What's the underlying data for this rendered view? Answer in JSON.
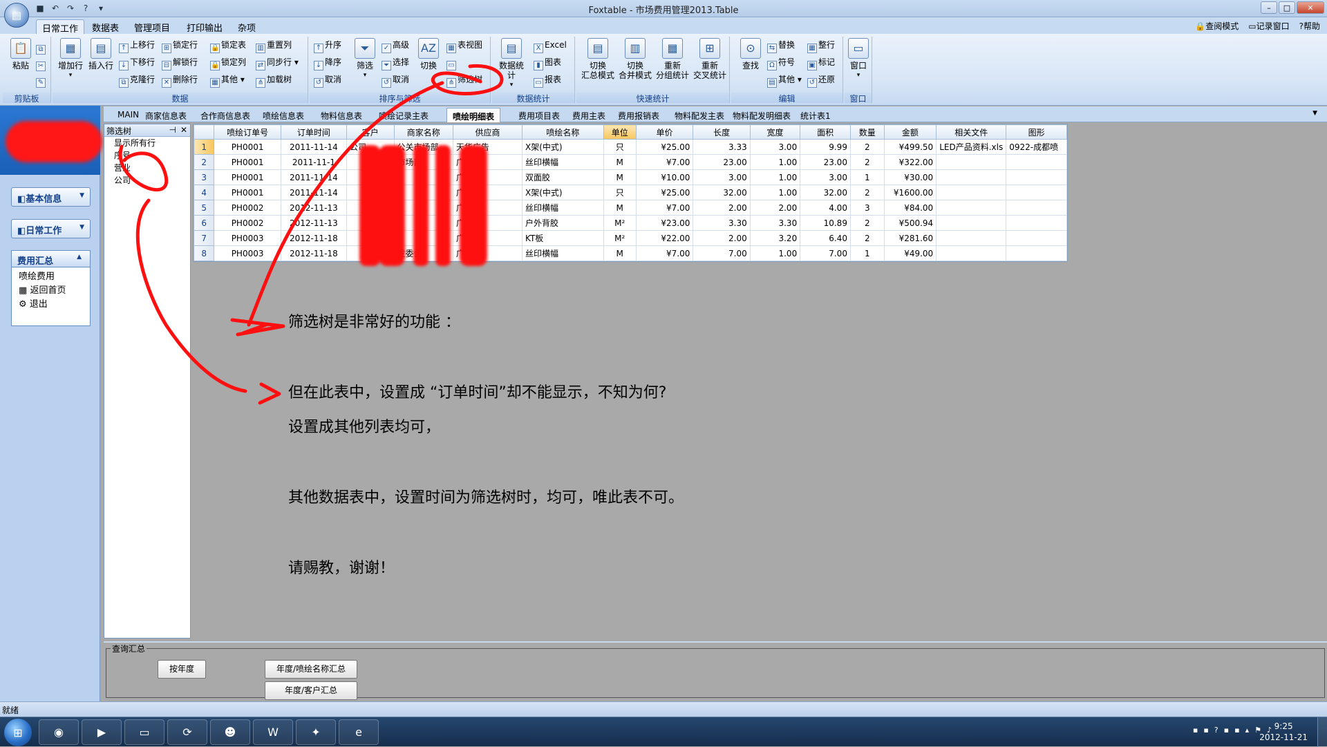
{
  "window": {
    "title": "Foxtable - 市场费用管理2013.Table"
  },
  "ribbon_tabs": [
    "日常工作",
    "数据表",
    "管理项目",
    "打印输出",
    "杂项"
  ],
  "right_links": [
    "查阅模式",
    "记录窗口",
    "帮助"
  ],
  "ribbon": {
    "clipboard": {
      "paste": "粘贴",
      "label": "剪贴板"
    },
    "data": {
      "add_row": "增加行",
      "insert_row": "插入行",
      "small": [
        "上移行",
        "锁定行",
        "锁定表",
        "重置列",
        "下移行",
        "解锁行",
        "锁定列",
        "同步行",
        "克隆行",
        "删除行",
        "其他",
        "加载树"
      ],
      "label": "数据"
    },
    "sort": {
      "small": [
        "升序",
        "降序",
        "取消",
        "高级",
        "选择",
        "取消"
      ],
      "filter": "筛选",
      "switch": "切换",
      "views": [
        "表视图",
        "筛选树"
      ],
      "label": "排序与筛选"
    },
    "stats": {
      "data_stats": "数据统计",
      "excel": "Excel",
      "chart": "图表",
      "report": "报表",
      "label": "数据统计"
    },
    "quick": {
      "b1a": "切换",
      "b1b": "汇总模式",
      "b2a": "切换",
      "b2b": "合并模式",
      "b3a": "重新",
      "b3b": "分组统计",
      "b4a": "重新",
      "b4b": "交叉统计",
      "label": "快速统计"
    },
    "edit": {
      "find": "查找",
      "replace": "替换",
      "symbol": "符号",
      "other": "其他",
      "tidy": "整行",
      "mark": "标记",
      "restore": "还原",
      "label": "编辑"
    },
    "window": {
      "btn": "窗口",
      "label": "窗口"
    }
  },
  "left_nav": {
    "buttons": [
      "基本信息",
      "日常工作"
    ],
    "group_title": "费用汇总",
    "group_items": [
      "喷绘费用",
      "返回首页",
      "退出"
    ]
  },
  "doc_tabs": [
    "MAIN",
    "商家信息表",
    "合作商信息表",
    "喷绘信息表",
    "物料信息表",
    "喷绘记录主表",
    "喷绘明细表",
    "费用项目表",
    "费用主表",
    "费用报销表",
    "物料配发主表",
    "物料配发明细表",
    "统计表1"
  ],
  "active_doc_tab": "喷绘明细表",
  "filter_tree": {
    "title": "筛选树",
    "items": [
      "显示所有行",
      "序号",
      "营业",
      "公司"
    ]
  },
  "table": {
    "columns": [
      "喷绘订单号",
      "订单时间",
      "客户",
      "商家名称",
      "供应商",
      "喷绘名称",
      "单位",
      "单价",
      "长度",
      "宽度",
      "面积",
      "数量",
      "金额",
      "相关文件",
      "图形"
    ],
    "rows": [
      [
        "1",
        "PH0001",
        "2011-11-14",
        "公司",
        "公关市场部",
        "天华广告",
        "X架(中式)",
        "只",
        "¥25.00",
        "3.33",
        "3.00",
        "9.99",
        "2",
        "¥499.50",
        "LED产品资料.xls",
        "0922-成都喷"
      ],
      [
        "2",
        "PH0001",
        "2011-11-1",
        "",
        "市场部",
        "广告",
        "丝印横幅",
        "M",
        "¥7.00",
        "23.00",
        "1.00",
        "23.00",
        "2",
        "¥322.00",
        "",
        ""
      ],
      [
        "3",
        "PH0001",
        "2011-11-14",
        "",
        "",
        "广告",
        "双面胶",
        "M",
        "¥10.00",
        "3.00",
        "1.00",
        "3.00",
        "1",
        "¥30.00",
        "",
        ""
      ],
      [
        "4",
        "PH0001",
        "2011-11-14",
        "",
        "",
        "广告",
        "X架(中式)",
        "只",
        "¥25.00",
        "32.00",
        "1.00",
        "32.00",
        "2",
        "¥1600.00",
        "",
        ""
      ],
      [
        "5",
        "PH0002",
        "2012-11-13",
        "",
        "",
        "广告",
        "丝印横幅",
        "M",
        "¥7.00",
        "2.00",
        "2.00",
        "4.00",
        "3",
        "¥84.00",
        "",
        ""
      ],
      [
        "6",
        "PH0002",
        "2012-11-13",
        "",
        "",
        "广告",
        "户外背胶",
        "M²",
        "¥23.00",
        "3.30",
        "3.30",
        "10.89",
        "2",
        "¥500.94",
        "",
        ""
      ],
      [
        "7",
        "PH0003",
        "2012-11-18",
        "",
        "",
        "广告",
        "KT板",
        "M²",
        "¥22.00",
        "2.00",
        "3.20",
        "6.40",
        "2",
        "¥281.60",
        "",
        ""
      ],
      [
        "8",
        "PH0003",
        "2012-11-18",
        "",
        "发委会",
        "广告",
        "丝印横幅",
        "M",
        "¥7.00",
        "7.00",
        "1.00",
        "7.00",
        "1",
        "¥49.00",
        "",
        ""
      ]
    ]
  },
  "annotation": {
    "lines": [
      "筛选树是非常好的功能 ：",
      "但在此表中，设置成 “订单时间”却不能显示，不知为何?",
      "设置成其他列表均可，",
      "其他数据表中，设置时间为筛选树时，均可，唯此表不可。",
      "请赐教，谢谢！"
    ]
  },
  "query": {
    "legend": "查询汇总",
    "btn_year": "按年度",
    "btn_year_name": "年度/喷绘名称汇总",
    "btn_year_client": "年度/客户汇总"
  },
  "status": {
    "text": "就绪"
  },
  "clock": {
    "time": "9:25",
    "date": "2012-11-21"
  },
  "colors": {
    "accent": "#15428b",
    "ink": "#ff0000"
  }
}
